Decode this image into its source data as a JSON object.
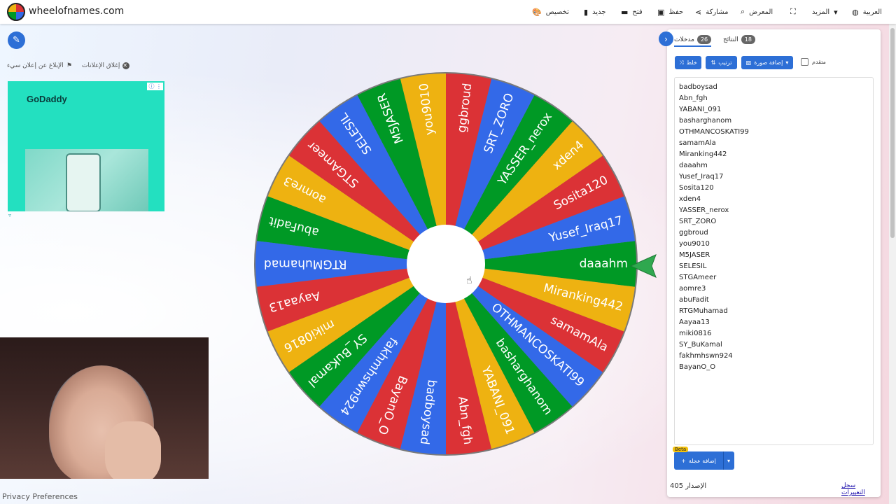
{
  "header": {
    "site_title": "wheelofnames.com",
    "nav": [
      {
        "label": "تخصيص",
        "icon": "palette-icon"
      },
      {
        "label": "جديد",
        "icon": "file-icon"
      },
      {
        "label": "فتح",
        "icon": "folder-icon"
      },
      {
        "label": "حفظ",
        "icon": "save-icon"
      },
      {
        "label": "مشاركة",
        "icon": "share-icon"
      },
      {
        "label": "المعرض",
        "icon": "search-icon"
      },
      {
        "label": "",
        "icon": "fullscreen-icon"
      },
      {
        "label": "المزيد",
        "icon": "caret-down-icon"
      },
      {
        "label": "العربية",
        "icon": "globe-icon"
      }
    ]
  },
  "ad": {
    "report_label": "الإبلاغ عن إعلان سيء",
    "close_label": "إغلاق الإعلانات",
    "brand": "GoDaddy"
  },
  "footer": {
    "privacy": "Privacy Preferences"
  },
  "wheel": {
    "segments": [
      {
        "label": "daaahm",
        "color": "#009925"
      },
      {
        "label": "Yusef_Iraq17",
        "color": "#3369e8"
      },
      {
        "label": "Sosita120",
        "color": "#db3236"
      },
      {
        "label": "xden4",
        "color": "#eeb211"
      },
      {
        "label": "YASSER_nerox",
        "color": "#009925"
      },
      {
        "label": "SRT_ZORO",
        "color": "#3369e8"
      },
      {
        "label": "ggbroud",
        "color": "#db3236"
      },
      {
        "label": "you9010",
        "color": "#eeb211"
      },
      {
        "label": "M5JASER",
        "color": "#009925"
      },
      {
        "label": "SELESIL",
        "color": "#3369e8"
      },
      {
        "label": "STGAmeer",
        "color": "#db3236"
      },
      {
        "label": "aomre3",
        "color": "#eeb211"
      },
      {
        "label": "abuFadit",
        "color": "#009925"
      },
      {
        "label": "RTGMuhamad",
        "color": "#3369e8"
      },
      {
        "label": "Aayaa13",
        "color": "#db3236"
      },
      {
        "label": "miki0816",
        "color": "#eeb211"
      },
      {
        "label": "SY_BuKamal",
        "color": "#009925"
      },
      {
        "label": "fakhmhswn924",
        "color": "#3369e8"
      },
      {
        "label": "BayanO_O",
        "color": "#db3236"
      },
      {
        "label": "badboysad",
        "color": "#3369e8"
      },
      {
        "label": "Abn_fgh",
        "color": "#db3236"
      },
      {
        "label": "YABANI_091",
        "color": "#eeb211"
      },
      {
        "label": "basharghanom",
        "color": "#009925"
      },
      {
        "label": "OTHMANCOSKATI99",
        "color": "#3369e8"
      },
      {
        "label": "samamAla",
        "color": "#db3236"
      },
      {
        "label": "Miranking442",
        "color": "#eeb211"
      }
    ]
  },
  "panel": {
    "tab_entries": {
      "label": "مدخلات",
      "count": "26"
    },
    "tab_results": {
      "label": "النتائج",
      "count": "18"
    },
    "shuffle_label": "خلط",
    "sort_label": "ترتيب",
    "add_image_label": "إضافة صورة",
    "advanced_label": "متقدم",
    "entries": [
      "badboysad",
      "Abn_fgh",
      "YABANI_091",
      "basharghanom",
      "OTHMANCOSKATI99",
      "samamAla",
      "Miranking442",
      "daaahm",
      "Yusef_Iraq17",
      "Sosita120",
      "xden4",
      "YASSER_nerox",
      "SRT_ZORO",
      "ggbroud",
      "you9010",
      "M5JASER",
      "SELESIL",
      "STGAmeer",
      "aomre3",
      "abuFadit",
      "RTGMuhamad",
      "Aayaa13",
      "miki0816",
      "SY_BuKamal",
      "fakhmhswn924",
      "BayanO_O"
    ],
    "add_wheel_label": "إضافة عجلة",
    "beta_label": "Beta",
    "version_label": "الإصدار 405",
    "changelog_label": "سجل التغييرات"
  }
}
